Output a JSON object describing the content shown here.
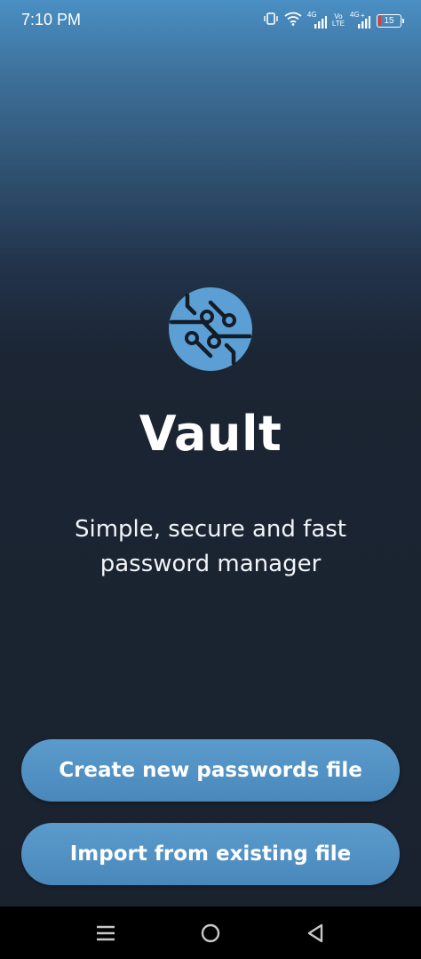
{
  "status_bar": {
    "time": "7:10 PM",
    "net1": "4G",
    "volte_top": "Vo",
    "volte_bottom": "LTE",
    "net2": "4G",
    "battery_level": "15",
    "battery_color": "#e53935"
  },
  "app": {
    "logo_icon": "circuit-logo-icon",
    "title": "Vault",
    "tagline_line1": "Simple, secure and fast",
    "tagline_line2": "password manager"
  },
  "actions": {
    "create_label": "Create new passwords file",
    "import_label": "Import from existing file"
  },
  "nav": {
    "menu_icon": "menu-icon",
    "home_icon": "home-icon",
    "back_icon": "back-icon"
  },
  "colors": {
    "accent": "#4a8fc4",
    "background": "#1a222e",
    "logo": "#5b9fd4"
  }
}
